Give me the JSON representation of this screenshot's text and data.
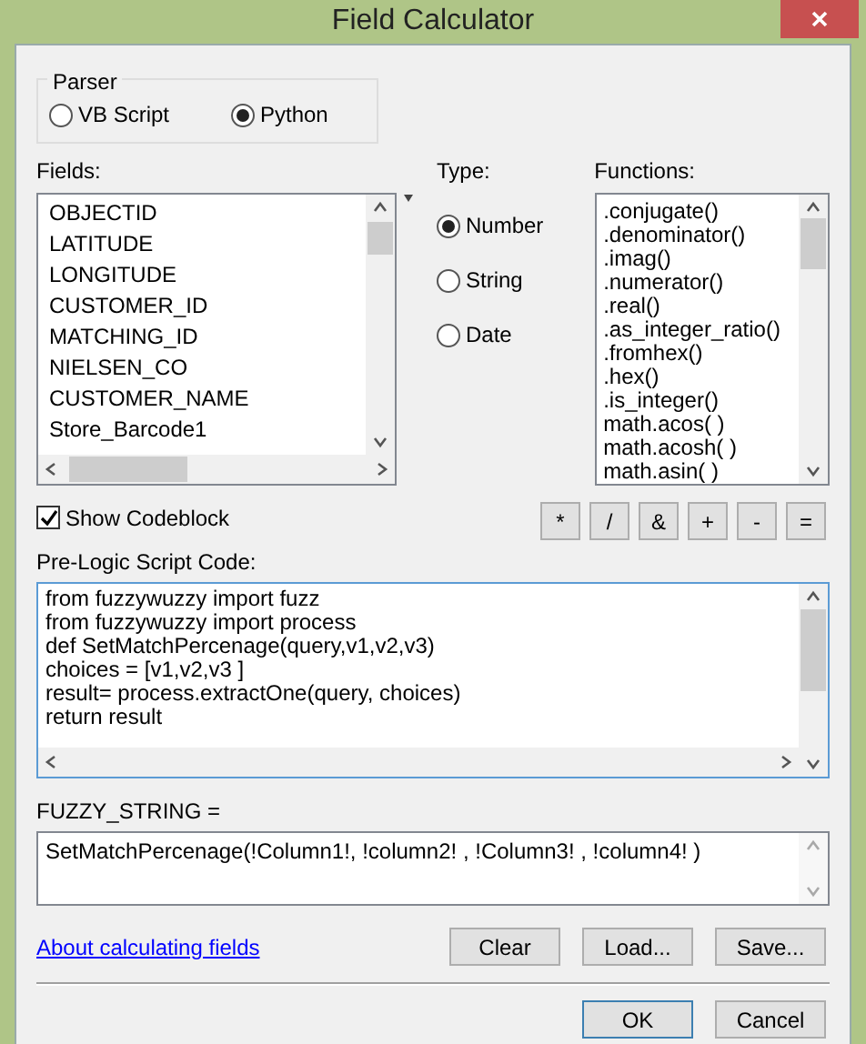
{
  "window": {
    "title": "Field Calculator"
  },
  "parser": {
    "label": "Parser",
    "options": [
      {
        "label": "VB Script",
        "selected": false
      },
      {
        "label": "Python",
        "selected": true
      }
    ]
  },
  "fields": {
    "label": "Fields:",
    "items": [
      "OBJECTID",
      "LATITUDE",
      "LONGITUDE",
      "CUSTOMER_ID",
      "MATCHING_ID",
      "NIELSEN_CO",
      "CUSTOMER_NAME",
      "Store_Barcode1"
    ]
  },
  "type": {
    "label": "Type:",
    "options": [
      {
        "label": "Number",
        "selected": true
      },
      {
        "label": "String",
        "selected": false
      },
      {
        "label": "Date",
        "selected": false
      }
    ]
  },
  "functions": {
    "label": "Functions:",
    "items": [
      ".conjugate()",
      ".denominator()",
      ".imag()",
      ".numerator()",
      ".real()",
      ".as_integer_ratio()",
      ".fromhex()",
      ".hex()",
      ".is_integer()",
      "math.acos( )",
      "math.acosh( )",
      "math.asin( )"
    ]
  },
  "show_codeblock": {
    "label": "Show Codeblock",
    "checked": true
  },
  "operators": [
    "*",
    "/",
    "&",
    "+",
    "-",
    "="
  ],
  "pre_logic": {
    "label": "Pre-Logic Script Code:",
    "lines": [
      "from fuzzywuzzy import fuzz",
      "from fuzzywuzzy import process",
      "def SetMatchPercenage(query,v1,v2,v3)",
      "choices = [v1,v2,v3 ]",
      "result= process.extractOne(query, choices)",
      "return result"
    ]
  },
  "expression": {
    "label": "FUZZY_STRING =",
    "value": "SetMatchPercenage(!Column1!, !column2! , !Column3! , !column4! )"
  },
  "help_link": "About calculating fields",
  "file_buttons": [
    "Clear",
    "Load...",
    "Save..."
  ],
  "dialog_buttons": [
    {
      "label": "OK",
      "default": true
    },
    {
      "label": "Cancel",
      "default": false
    }
  ]
}
